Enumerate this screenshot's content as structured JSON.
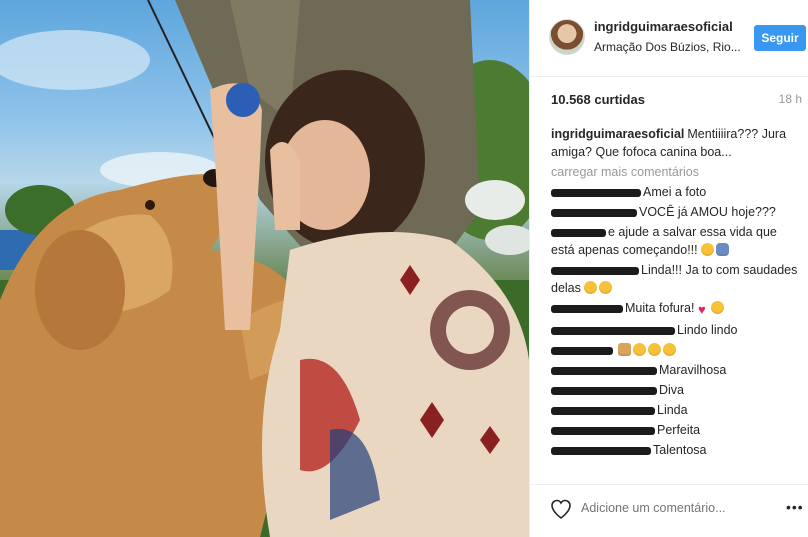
{
  "post": {
    "username": "ingridguimaraesoficial",
    "location": "Armação Dos Búzios, Rio...",
    "follow_label": "Seguir",
    "likes": "10.568 curtidas",
    "time": "18 h",
    "caption_user": "ingridguimaraesoficial",
    "caption_text": "Mentiiiira??? Jura amiga? Que fofoca canina boa...",
    "load_more": "carregar mais comentários",
    "add_comment_placeholder": "Adicione um comentário...",
    "more_label": "•••"
  },
  "comments": [
    {
      "text": "Amei a foto",
      "emoji": []
    },
    {
      "text": "VOCÊ já AMOU hoje???",
      "emoji": []
    },
    {
      "text": "e ajude a salvar essa vida que está apenas começando!!!",
      "emoji": [
        "smile",
        "person"
      ]
    },
    {
      "text": "Linda!!! Ja to com saudades delas",
      "emoji": [
        "tongue",
        "grin"
      ]
    },
    {
      "text": "Muita fofura!",
      "emoji": [
        "heart",
        "tongue"
      ]
    },
    {
      "text": "Lindo lindo",
      "emoji": []
    },
    {
      "text": "",
      "emoji": [
        "dog",
        "hearteyes",
        "hearteyes",
        "hearteyes"
      ]
    },
    {
      "text": "Maravilhosa",
      "emoji": []
    },
    {
      "text": "Diva",
      "emoji": []
    },
    {
      "text": "Linda",
      "emoji": []
    },
    {
      "text": "Perfeita",
      "emoji": []
    },
    {
      "text": "Talentosa",
      "emoji": []
    }
  ],
  "colors": {
    "accent": "#3897f0",
    "text": "#262626",
    "muted": "#999999",
    "border": "#efefef"
  },
  "icons": {
    "like": "heart-outline-icon",
    "more": "more-dots-icon"
  }
}
